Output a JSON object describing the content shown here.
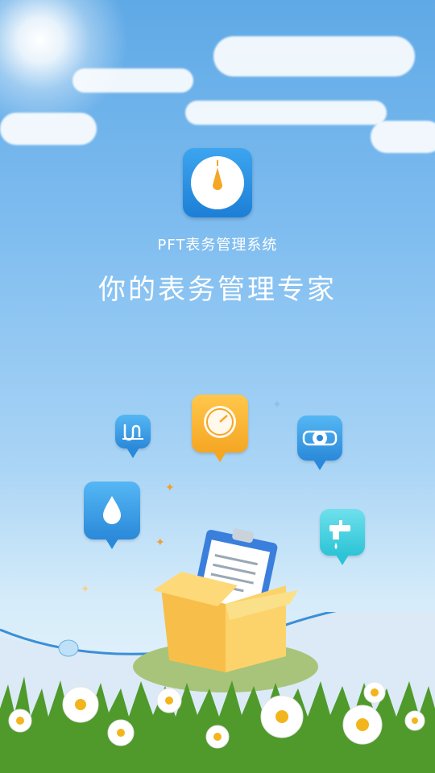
{
  "app": {
    "name": "PFT表务管理系统",
    "slogan": "你的表务管理专家"
  },
  "colors": {
    "sky_top": "#5fa9e6",
    "sky_bottom": "#eef7fd",
    "logo_blue": "#1c7fd6",
    "accent_orange": "#f5a623",
    "accent_cyan": "#2cc4d6"
  },
  "icons": [
    "gauge-icon",
    "meter-icon",
    "water-drop-icon",
    "flow-meter-icon",
    "faucet-icon",
    "clipboard-icon",
    "box-icon"
  ]
}
